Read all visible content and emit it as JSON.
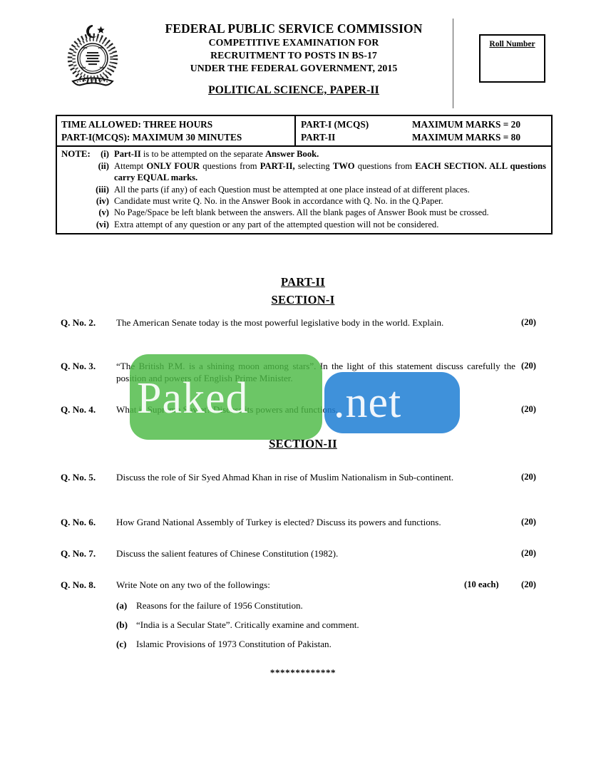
{
  "header": {
    "emblem_name": "fpsc-emblem",
    "organization": "FEDERAL PUBLIC SERVICE COMMISSION",
    "line2": "COMPETITIVE EXAMINATION FOR",
    "line3": "RECRUITMENT TO POSTS IN BS-17",
    "line4": "UNDER THE FEDERAL GOVERNMENT, 2015",
    "paper_title": "POLITICAL SCIENCE, PAPER-II",
    "roll_number_label": "Roll Number"
  },
  "info": {
    "time_allowed": "TIME ALLOWED:  THREE HOURS",
    "part1_time": "PART-I(MCQS):       MAXIMUM 30 MINUTES",
    "part1_label": "PART-I (MCQS)",
    "part1_marks": "MAXIMUM MARKS = 20",
    "part2_label": "PART-II",
    "part2_marks": "MAXIMUM MARKS = 80"
  },
  "note": {
    "label": "NOTE:",
    "items": [
      {
        "numeral": "(i)",
        "segments": [
          {
            "text": "Part-II",
            "bold": true
          },
          {
            "text": " is to be attempted on the separate ",
            "bold": false
          },
          {
            "text": "Answer Book.",
            "bold": true
          }
        ]
      },
      {
        "numeral": "(ii)",
        "segments": [
          {
            "text": "Attempt ",
            "bold": false
          },
          {
            "text": "ONLY FOUR",
            "bold": true
          },
          {
            "text": " questions from ",
            "bold": false
          },
          {
            "text": "PART-II,",
            "bold": true
          },
          {
            "text": " selecting ",
            "bold": false
          },
          {
            "text": "TWO",
            "bold": true
          },
          {
            "text": " questions from ",
            "bold": false
          },
          {
            "text": "EACH SECTION. ALL questions carry EQUAL marks.",
            "bold": true
          }
        ]
      },
      {
        "numeral": "(iii)",
        "segments": [
          {
            "text": "All the parts (if any) of each Question must be attempted at one place instead of at different places.",
            "bold": false
          }
        ]
      },
      {
        "numeral": "(iv)",
        "segments": [
          {
            "text": "Candidate must write Q. No. in the Answer Book in accordance with Q. No. in the Q.Paper.",
            "bold": false
          }
        ]
      },
      {
        "numeral": "(v)",
        "segments": [
          {
            "text": "No Page/Space be left blank between the answers. All the blank pages of Answer Book must be crossed.",
            "bold": false
          }
        ]
      },
      {
        "numeral": "(vi)",
        "segments": [
          {
            "text": "Extra attempt of any question or any part of the attempted question will not be considered.",
            "bold": false
          }
        ]
      }
    ]
  },
  "part_heading": "PART-II",
  "section1_heading": "SECTION-I",
  "section2_heading": "SECTION-II",
  "questions": {
    "q2": {
      "number": "Q. No. 2.",
      "text": "The American Senate today is the most powerful legislative body in the world. Explain.",
      "marks": "(20)"
    },
    "q3": {
      "number": "Q. No. 3.",
      "text": "“The British P.M. is a shining moon among stars”. In the light of this statement discuss carefully the position and powers of English Prime Minister.",
      "marks": "(20)"
    },
    "q4": {
      "number": "Q. No. 4.",
      "text": "What is Supreme Soviet? Discuss its powers and functions.",
      "marks": "(20)"
    },
    "q5": {
      "number": "Q. No. 5.",
      "text": "Discuss the role of Sir Syed Ahmad Khan in rise of Muslim Nationalism in Sub-continent.",
      "marks": "(20)"
    },
    "q6": {
      "number": "Q. No. 6.",
      "text": "How Grand National Assembly of Turkey is elected? Discuss its powers and functions.",
      "marks": "(20)"
    },
    "q7": {
      "number": "Q. No. 7.",
      "text": "Discuss the salient features of Chinese Constitution (1982).",
      "marks": "(20)"
    },
    "q8": {
      "number": "Q. No. 8.",
      "text": "Write Note on any two of the followings:",
      "each": "(10 each)",
      "marks": "(20)",
      "subitems": [
        {
          "label": "(a)",
          "text": "Reasons for the failure of 1956 Constitution."
        },
        {
          "label": "(b)",
          "text": "“India is a Secular State”. Critically examine and comment."
        },
        {
          "label": "(c)",
          "text": "Islamic Provisions of 1973 Constitution of Pakistan."
        }
      ]
    }
  },
  "footer": {
    "stars": "*************"
  },
  "watermark": {
    "text_left": "Paked",
    "text_right": ".net",
    "color_left": "#4cb944",
    "color_right": "#1f7fd4"
  }
}
